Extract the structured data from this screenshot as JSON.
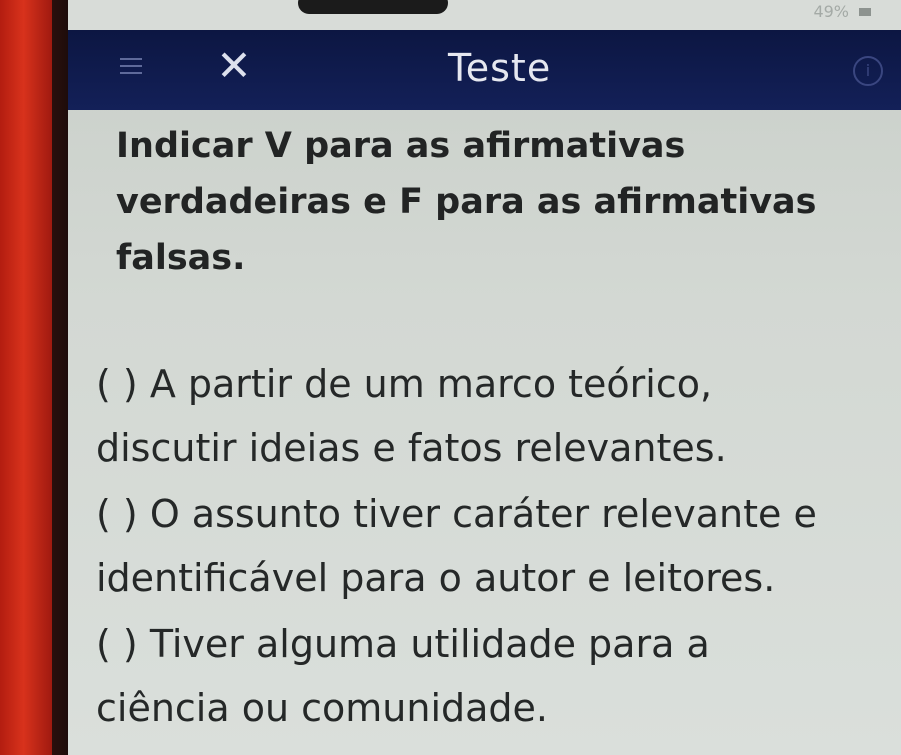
{
  "status_bar": {
    "battery_percent": "49%"
  },
  "app_bar": {
    "menu_icon": "menu-icon",
    "close_icon": "close-icon",
    "title": "Teste",
    "info_icon": "info-icon",
    "background_color": "#0c1642"
  },
  "question": {
    "instruction_line1": "Indicar V para as afirmativas",
    "instruction_line2": "verdadeiras e F para as afirmativas",
    "instruction_line3": "falsas.",
    "statements": [
      {
        "marker": "( )",
        "line1": " A partir de um marco teórico,",
        "line2": "discutir ideias e fatos relevantes."
      },
      {
        "marker": "( )",
        "line1": " O assunto tiver caráter relevante e",
        "line2": "identificável para o autor e leitores."
      },
      {
        "marker": "( )",
        "line1": " Tiver alguma utilidade para a",
        "line2": "ciência ou comunidade."
      }
    ]
  }
}
